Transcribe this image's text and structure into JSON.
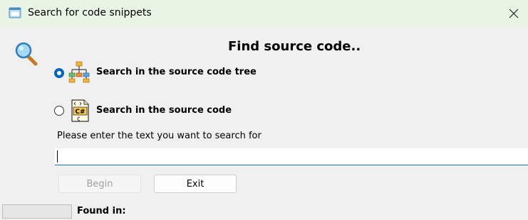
{
  "window": {
    "title": "Search for code snippets"
  },
  "icons": {
    "app": "window-app-icon",
    "close": "close-icon",
    "search": "magnifier-icon",
    "tree": "tree-hierarchy-icon",
    "csharp": "csharp-file-icon",
    "csharp_text": "C#"
  },
  "main": {
    "heading": "Find source code.."
  },
  "options": [
    {
      "label": "Search in the source code tree",
      "selected": true
    },
    {
      "label": "Search in the source code",
      "selected": false
    }
  ],
  "search": {
    "prompt": "Please enter the text you want to search for",
    "value": ""
  },
  "buttons": {
    "begin": "Begin",
    "exit": "Exit",
    "begin_enabled": false
  },
  "status": {
    "found_in_label": "Found in:"
  },
  "colors": {
    "accent": "#0067c0",
    "titlebar": "#eaf4e4",
    "background": "#f0f0f0"
  }
}
